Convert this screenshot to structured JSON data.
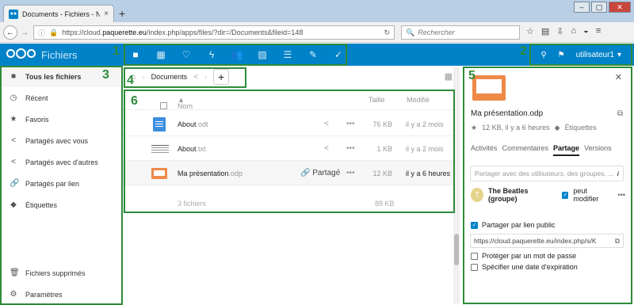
{
  "browser": {
    "tab_title": "Documents - Fichiers - Nex...",
    "tab_icon": "nextcloud-icon",
    "url_prefix": "https://cloud.",
    "url_host": "paquerette.eu",
    "url_path": "/index.php/apps/files/?dir=/Documents&fileid=148",
    "search_placeholder": "Rechercher"
  },
  "header": {
    "app_title": "Fichiers",
    "apps": [
      "files-icon",
      "calendar-icon",
      "heart-icon",
      "activity-icon",
      "contacts-icon",
      "gallery-icon",
      "notes-icon",
      "tasks-icon",
      "checkmark-icon"
    ],
    "username": "utilisateur1"
  },
  "annotations": [
    "1",
    "2",
    "3",
    "4",
    "5",
    "6"
  ],
  "sidebar": {
    "items": [
      {
        "label": "Tous les fichiers",
        "icon": "folder-icon"
      },
      {
        "label": "Récent",
        "icon": "clock-icon"
      },
      {
        "label": "Favoris",
        "icon": "star-icon"
      },
      {
        "label": "Partagés avec vous",
        "icon": "share-icon"
      },
      {
        "label": "Partagés avec d'autres",
        "icon": "share-icon"
      },
      {
        "label": "Partagés par lien",
        "icon": "link-icon"
      },
      {
        "label": "Étiquettes",
        "icon": "tag-icon"
      }
    ],
    "bottom": [
      {
        "label": "Fichiers supprimés",
        "icon": "trash-icon"
      },
      {
        "label": "Paramètres",
        "icon": "gear-icon"
      }
    ]
  },
  "breadcrumb": {
    "current": "Documents"
  },
  "table": {
    "col_name": "Nom",
    "col_size": "Taille",
    "col_modified": "Modifié",
    "rows": [
      {
        "base": "About",
        "ext": ".odt",
        "size": "76 KB",
        "modified": "il y a 2 mois",
        "shared": ""
      },
      {
        "base": "About",
        "ext": ".txt",
        "size": "1 KB",
        "modified": "il y a 2 mois",
        "shared": ""
      },
      {
        "base": "Ma présentation",
        "ext": ".odp",
        "size": "12 KB",
        "modified": "il y a 6 heures",
        "shared": "Partagé"
      }
    ],
    "summary_count": "3 fichiers",
    "summary_size": "88 KB"
  },
  "panel": {
    "filename": "Ma présentation.odp",
    "meta": "12 KB, il y a 6 heures",
    "tags_label": "Étiquettes",
    "tabs": [
      "Activités",
      "Commentaires",
      "Partage",
      "Versions"
    ],
    "active_tab": "Partage",
    "share_placeholder": "Partager avec des utilisateurs, des groupes, ...",
    "sharee_name": "The Beatles (groupe)",
    "sharee_initial": "T",
    "can_edit_label": "peut modifier",
    "public_link_label": "Partager par lien public",
    "public_link": "https://cloud.paquerette.eu/index.php/s/K",
    "password_label": "Protéger par un mot de passe",
    "expiry_label": "Spécifier une date d'expiration"
  },
  "colors": {
    "brand": "#0082c9",
    "annotation": "#2e8b3a",
    "presentation": "#ee8948"
  }
}
